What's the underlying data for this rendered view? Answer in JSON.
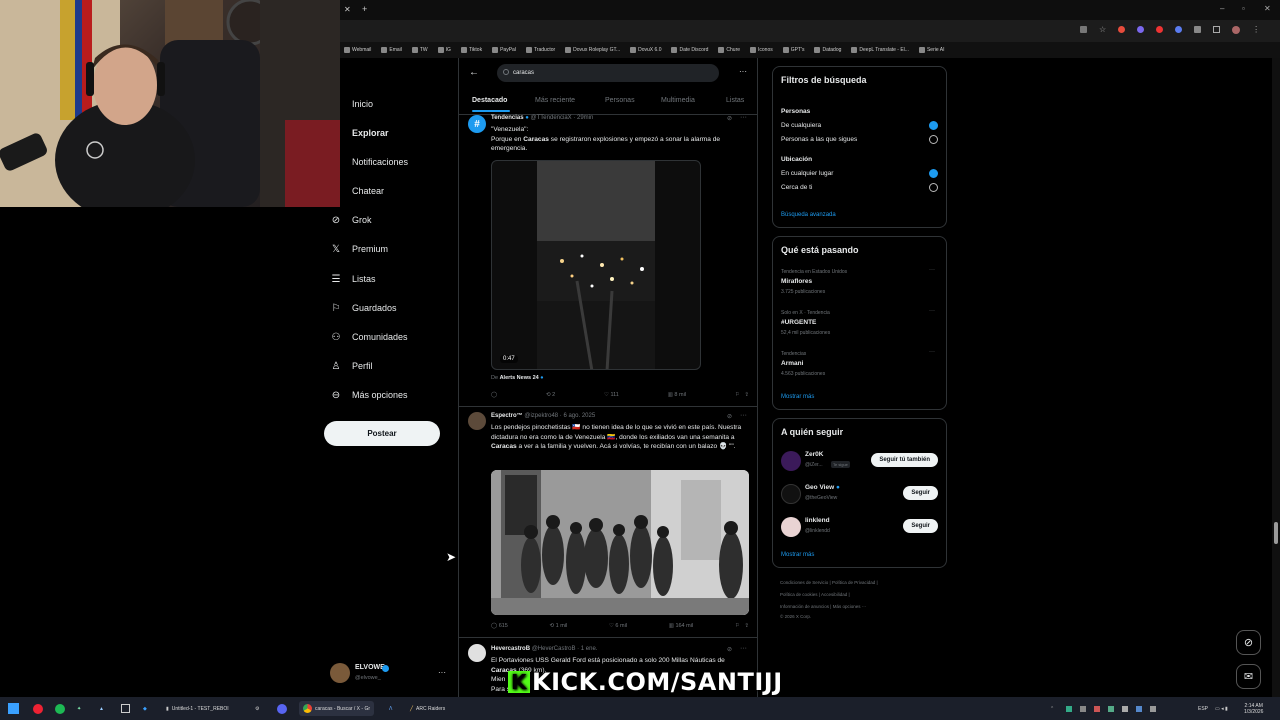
{
  "bookmarks": [
    "Webmail",
    "Email",
    "TW",
    "IG",
    "Tiktok",
    "PayPal",
    "Traductor",
    "Dovux Roleplay GT...",
    "DovuX 6.0",
    "Date Discord",
    "Chure",
    "Iconos",
    "GPT's",
    "Datadog",
    "DeepL Translate - El...",
    "Serie AI"
  ],
  "nav": {
    "items": [
      "Inicio",
      "Explorar",
      "Notificaciones",
      "Chatear",
      "Grok",
      "Premium",
      "Listas",
      "Guardados",
      "Comunidades",
      "Perfil",
      "Más opciones"
    ],
    "post_label": "Postear",
    "account_name": "ELVOWE",
    "account_handle": "@elvowe_"
  },
  "search": {
    "value": "caracas"
  },
  "tabs": [
    "Destacado",
    "Más reciente",
    "Personas",
    "Multimedia",
    "Listas"
  ],
  "tweets": [
    {
      "name": "Tendencias",
      "handle": "@TTendenciaX · 29min",
      "text_line1": "\"Venezuela\":",
      "text_pre": "Porque en ",
      "text_bold": "Caracas",
      "text_post": " se registraron explosiones y empezó a sonar la alarma de emergencia.",
      "video_time": "0:47",
      "from_prefix": "De ",
      "from_name": "Alerts News 24",
      "stats": {
        "reposts": "2",
        "likes": "111",
        "views": "8 mil"
      }
    },
    {
      "name": "Espectro™",
      "handle": "@izpektro48 · 6 ago. 2025",
      "text_a": "Los pendejos pinochetistas 🇨🇱 no tienen idea de lo que se vivió en este país. Nuestra dictadura no era como la de Venezuela 🇻🇪, donde los exiliados van una semanita a ",
      "text_bold": "Caracas",
      "text_b": " a ver a la familia y vuelven. Acá si volvías, te recibían con un balazo 💀 \"\".",
      "stats": {
        "replies": "615",
        "reposts": "1 mil",
        "likes": "6 mil",
        "views": "164 mil"
      }
    },
    {
      "name": "HevercastroB",
      "handle": "@HeverCastroB · 1 ene.",
      "text_a": "El Portaviones USS Gerald Ford está posicionado a solo 200 Millas Náuticas de ",
      "text_bold": "Caracas",
      "text_b": " (369 km).",
      "text_c": "Mien",
      "text_d": "Para s"
    }
  ],
  "filters": {
    "title": "Filtros de búsqueda",
    "people_title": "Personas",
    "people_opts": [
      "De cualquiera",
      "Personas a las que sigues"
    ],
    "location_title": "Ubicación",
    "location_opts": [
      "En cualquier lugar",
      "Cerca de ti"
    ],
    "advanced": "Búsqueda avanzada"
  },
  "trends": {
    "title": "Qué está pasando",
    "items": [
      {
        "context": "Tendencia en Estados Unidos",
        "name": "Miraflores",
        "count": "3.725 publicaciones"
      },
      {
        "context": "Solo en X · Tendencia",
        "name": "#URGENTE",
        "count": "52,4 mil publicaciones"
      },
      {
        "context": "Tendencias",
        "name": "Armani",
        "count": "4.563 publicaciones"
      }
    ],
    "more": "Mostrar más"
  },
  "follow": {
    "title": "A quién seguir",
    "items": [
      {
        "name": "Zer0K",
        "handle": "@iZer...",
        "badge": "Te sigue",
        "button": "Seguir tú también"
      },
      {
        "name": "Geo View",
        "handle": "@theGeoView",
        "button": "Seguir"
      },
      {
        "name": "linklend",
        "handle": "@linklendd",
        "button": "Seguir"
      }
    ],
    "more": "Mostrar más"
  },
  "footer": {
    "line1": "Condiciones de Servicio  |  Política de Privacidad  |",
    "line2": "Política de cookies  |  Accesibilidad  |",
    "line3": "Información de anuncios  |  Más opciones ···",
    "line4": "© 2026 X Corp."
  },
  "overlay": {
    "kick": "KICK.COM/SANTIJJ"
  },
  "taskbar": {
    "vscode": "Untitled-1 - TEST_REBOI",
    "chrome": "caracas - Buscar / X - Gr",
    "arc": "ARC Raiders",
    "lang": "ESP",
    "time": "2:14 AM",
    "date": "1/3/2026"
  }
}
